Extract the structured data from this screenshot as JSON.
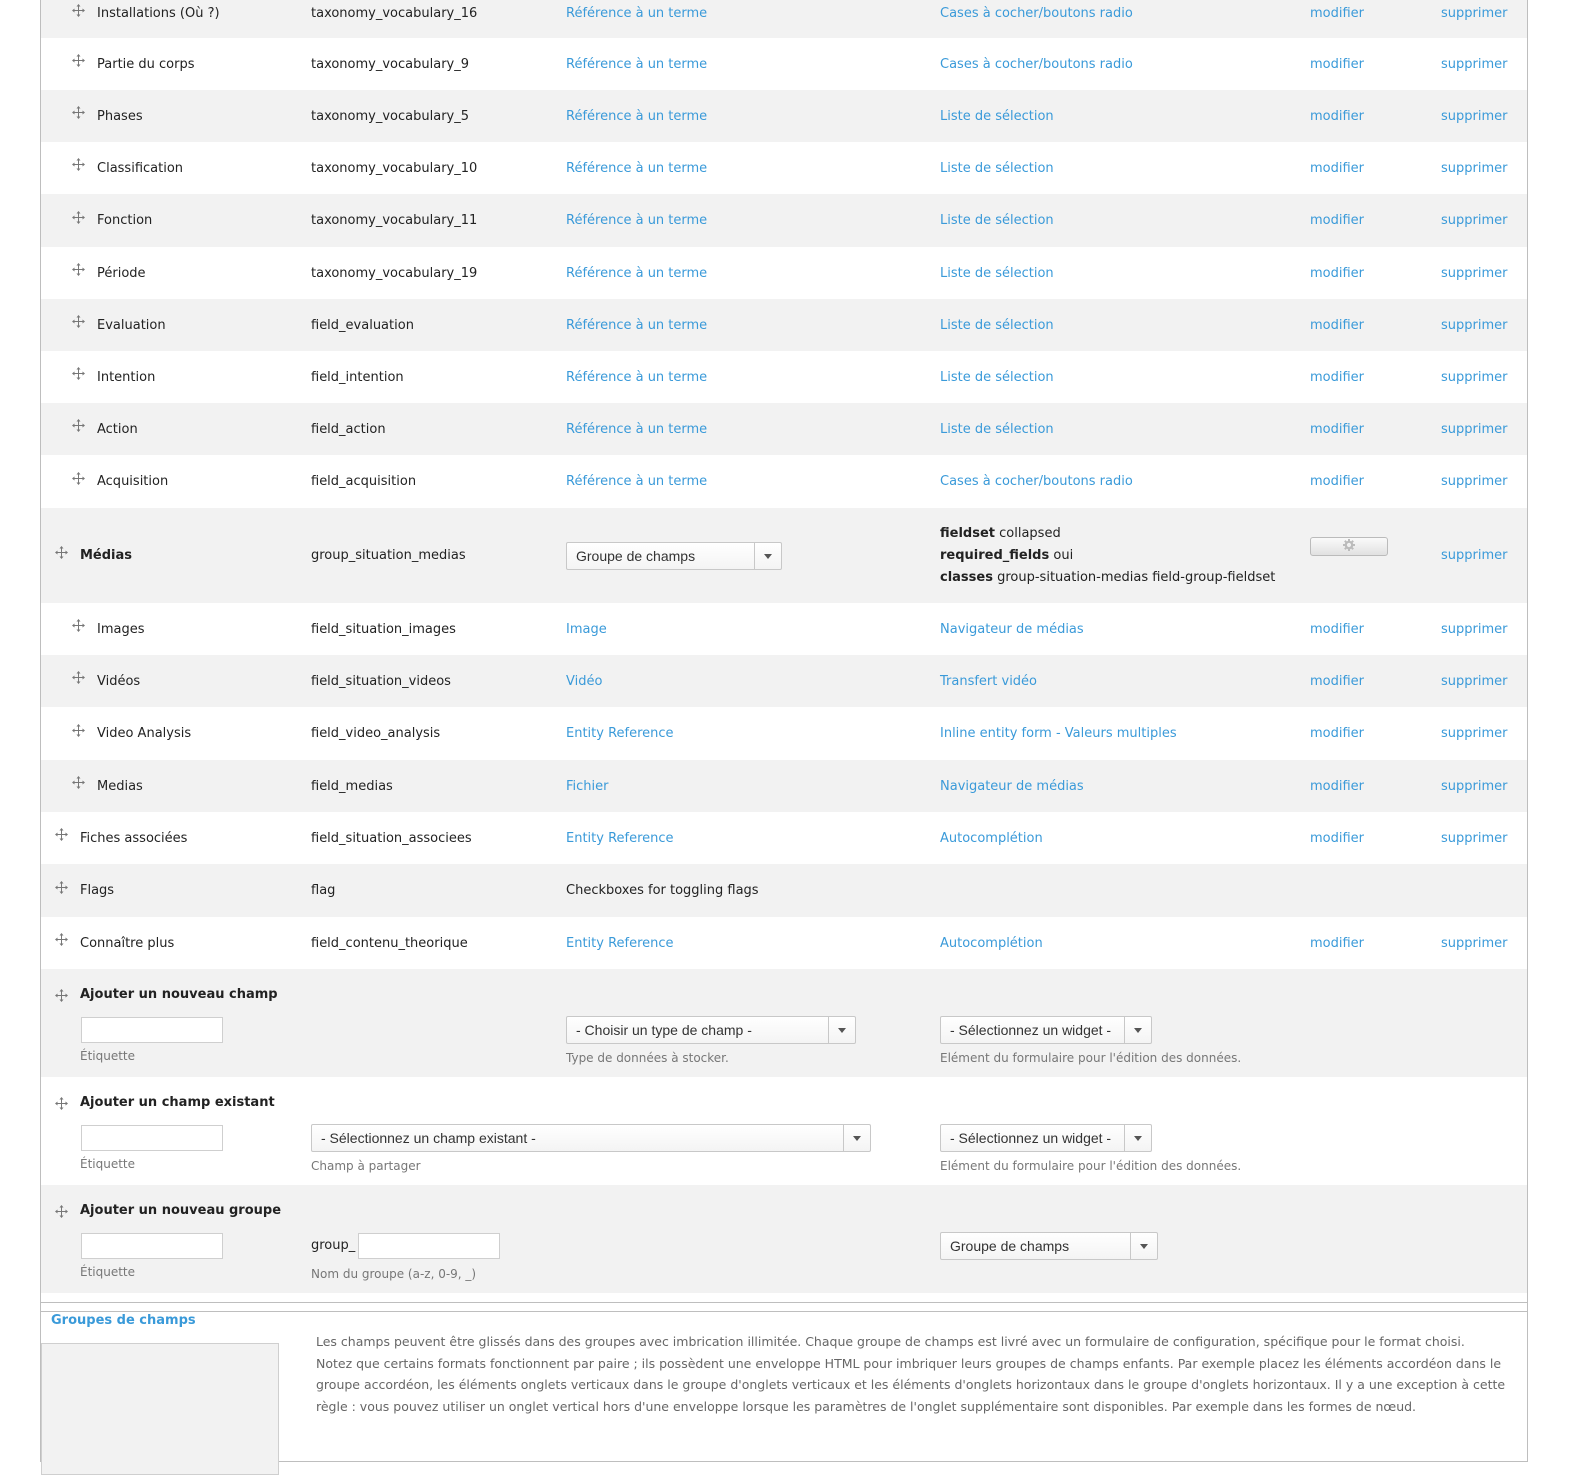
{
  "rows": [
    {
      "label": "Installations (Où ?)",
      "machine": "taxonomy_vocabulary_16",
      "type": "Référence à un terme",
      "widget": "Cases à cocher/boutons radio",
      "edit": "modifier",
      "delete": "supprimer",
      "level": 1
    },
    {
      "label": "Partie du corps",
      "machine": "taxonomy_vocabulary_9",
      "type": "Référence à un terme",
      "widget": "Cases à cocher/boutons radio",
      "edit": "modifier",
      "delete": "supprimer",
      "level": 1
    },
    {
      "label": "Phases",
      "machine": "taxonomy_vocabulary_5",
      "type": "Référence à un terme",
      "widget": "Liste de sélection",
      "edit": "modifier",
      "delete": "supprimer",
      "level": 1
    },
    {
      "label": "Classification",
      "machine": "taxonomy_vocabulary_10",
      "type": "Référence à un terme",
      "widget": "Liste de sélection",
      "edit": "modifier",
      "delete": "supprimer",
      "level": 1
    },
    {
      "label": "Fonction",
      "machine": "taxonomy_vocabulary_11",
      "type": "Référence à un terme",
      "widget": "Liste de sélection",
      "edit": "modifier",
      "delete": "supprimer",
      "level": 1
    },
    {
      "label": "Période",
      "machine": "taxonomy_vocabulary_19",
      "type": "Référence à un terme",
      "widget": "Liste de sélection",
      "edit": "modifier",
      "delete": "supprimer",
      "level": 1
    },
    {
      "label": "Evaluation",
      "machine": "field_evaluation",
      "type": "Référence à un terme",
      "widget": "Liste de sélection",
      "edit": "modifier",
      "delete": "supprimer",
      "level": 1
    },
    {
      "label": "Intention",
      "machine": "field_intention",
      "type": "Référence à un terme",
      "widget": "Liste de sélection",
      "edit": "modifier",
      "delete": "supprimer",
      "level": 1
    },
    {
      "label": "Action",
      "machine": "field_action",
      "type": "Référence à un terme",
      "widget": "Liste de sélection",
      "edit": "modifier",
      "delete": "supprimer",
      "level": 1
    },
    {
      "label": "Acquisition",
      "machine": "field_acquisition",
      "type": "Référence à un terme",
      "widget": "Cases à cocher/boutons radio",
      "edit": "modifier",
      "delete": "supprimer",
      "level": 1
    }
  ],
  "group_row": {
    "label": "Médias",
    "machine": "group_situation_medias",
    "select": "Groupe de champs",
    "settings": [
      {
        "key": "fieldset",
        "value": "collapsed"
      },
      {
        "key": "required_fields",
        "value": "oui"
      },
      {
        "key": "classes",
        "value": "group-situation-medias field-group-fieldset"
      }
    ],
    "delete": "supprimer"
  },
  "rows2": [
    {
      "label": "Images",
      "machine": "field_situation_images",
      "type": "Image",
      "widget": "Navigateur de médias",
      "edit": "modifier",
      "delete": "supprimer",
      "level": 1
    },
    {
      "label": "Vidéos",
      "machine": "field_situation_videos",
      "type": "Vidéo",
      "widget": "Transfert vidéo",
      "edit": "modifier",
      "delete": "supprimer",
      "level": 1
    },
    {
      "label": "Video Analysis",
      "machine": "field_video_analysis",
      "type": "Entity Reference",
      "widget": "Inline entity form - Valeurs multiples",
      "edit": "modifier",
      "delete": "supprimer",
      "level": 1
    },
    {
      "label": "Medias",
      "machine": "field_medias",
      "type": "Fichier",
      "widget": "Navigateur de médias",
      "edit": "modifier",
      "delete": "supprimer",
      "level": 1
    },
    {
      "label": "Fiches associées",
      "machine": "field_situation_associees",
      "type": "Entity Reference",
      "widget": "Autocomplétion",
      "edit": "modifier",
      "delete": "supprimer",
      "level": 0
    },
    {
      "label": "Flags",
      "machine": "flag",
      "type": "Checkboxes for toggling flags",
      "widget": "",
      "edit": "",
      "delete": "",
      "level": 0,
      "plain_type": true
    },
    {
      "label": "Connaître plus",
      "machine": "field_contenu_theorique",
      "type": "Entity Reference",
      "widget": "Autocomplétion",
      "edit": "modifier",
      "delete": "supprimer",
      "level": 0
    }
  ],
  "add_new_field": {
    "title": "Ajouter un nouveau champ",
    "label_desc": "Étiquette",
    "type_select": "- Choisir un type de champ -",
    "type_desc": "Type de données à stocker.",
    "widget_select": "- Sélectionnez un widget -",
    "widget_desc": "Elément du formulaire pour l'édition des données."
  },
  "add_existing_field": {
    "title": "Ajouter un champ existant",
    "label_desc": "Étiquette",
    "field_select": "- Sélectionnez un champ existant -",
    "field_desc": "Champ à partager",
    "widget_select": "- Sélectionnez un widget -",
    "widget_desc": "Elément du formulaire pour l'édition des données."
  },
  "add_new_group": {
    "title": "Ajouter un nouveau groupe",
    "label_desc": "Étiquette",
    "prefix": "group_",
    "name_desc": "Nom du groupe (a-z, 0-9, _)",
    "format_select": "Groupe de champs"
  },
  "field_groups": {
    "legend": "Groupes de champs",
    "line1": "Les champs peuvent être glissés dans des groupes avec imbrication illimitée. Chaque groupe de champs est livré avec un formulaire de configuration, spécifique pour le format choisi.",
    "line2": "Notez que certains formats fonctionnent par paire ; ils possèdent une enveloppe HTML pour imbriquer leurs groupes de champs enfants. Par exemple placez les éléments accordéon dans le groupe accordéon, les éléments onglets verticaux dans le groupe d'onglets verticaux et les éléments d'onglets horizontaux dans le groupe d'onglets horizontaux. Il y a une exception à cette règle : vous pouvez utiliser un onglet vertical hors d'une enveloppe lorsque les paramètres de l'onglet supplémentaire sont disponibles. Par exemple dans les formes de nœud."
  },
  "colors": {
    "link": "#3a9ad9",
    "row_alt": "#f2f2f2",
    "border": "#bebebe"
  }
}
